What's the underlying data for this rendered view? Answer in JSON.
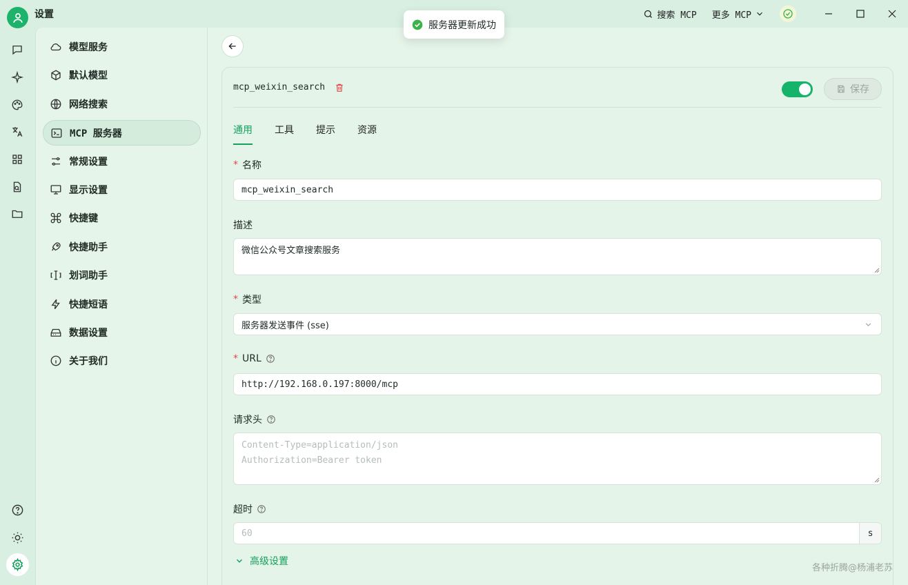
{
  "window": {
    "title": "设置",
    "search_label": "搜索 MCP",
    "more_label": "更多 MCP"
  },
  "toast": {
    "message": "服务器更新成功"
  },
  "sidebar": {
    "items": [
      {
        "label": "模型服务",
        "icon": "cloud-icon"
      },
      {
        "label": "默认模型",
        "icon": "cube-icon"
      },
      {
        "label": "网络搜索",
        "icon": "globe-icon"
      },
      {
        "label": "MCP 服务器",
        "icon": "terminal-icon",
        "active": true
      },
      {
        "label": "常规设置",
        "icon": "sliders-icon"
      },
      {
        "label": "显示设置",
        "icon": "monitor-icon"
      },
      {
        "label": "快捷键",
        "icon": "command-icon"
      },
      {
        "label": "快捷助手",
        "icon": "rocket-icon"
      },
      {
        "label": "划词助手",
        "icon": "text-select-icon"
      },
      {
        "label": "快捷短语",
        "icon": "zap-icon"
      },
      {
        "label": "数据设置",
        "icon": "hard-drive-icon"
      },
      {
        "label": "关于我们",
        "icon": "info-icon"
      }
    ]
  },
  "server": {
    "name": "mcp_weixin_search",
    "enabled": true,
    "save_label": "保存"
  },
  "tabs": [
    "通用",
    "工具",
    "提示",
    "资源"
  ],
  "form": {
    "name": {
      "label": "名称",
      "value": "mcp_weixin_search"
    },
    "description": {
      "label": "描述",
      "value": "微信公众号文章搜索服务"
    },
    "type": {
      "label": "类型",
      "value": "服务器发送事件 (sse)"
    },
    "url": {
      "label": "URL",
      "value": "http://192.168.0.197:8000/mcp"
    },
    "headers": {
      "label": "请求头",
      "placeholder_line1": "Content-Type=application/json",
      "placeholder_line2": "Authorization=Bearer token"
    },
    "timeout": {
      "label": "超时",
      "placeholder": "60",
      "unit": "s"
    },
    "advanced_label": "高级设置"
  },
  "watermark": "各种折腾@杨浦老苏",
  "colors": {
    "accent": "#16a05e",
    "toggle": "#16b36b",
    "danger": "#e5484d"
  }
}
